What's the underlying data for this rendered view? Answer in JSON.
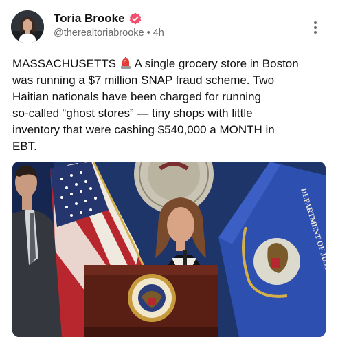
{
  "post": {
    "author_name": "Toria Brooke",
    "handle": "@therealtoriabrooke",
    "separator": "•",
    "time_ago": "4h",
    "text_before_icon": "MASSACHUSETTS ",
    "icon": "siren-emoji",
    "text_after_icon": " A single grocery store in Boston\nwas running a $7 million SNAP fraud scheme. Two\nHaitian nationals have been charged for running\nso-called “ghost stores” — tiny shops with little\ninventory that were cashing $540,000 a MONTH in\nEBT.",
    "media": {
      "podium_seal_text": "DEPARTMENT OF JUSTICE",
      "flag_text": "DEPARTMENT OF JUSTICE"
    }
  },
  "colors": {
    "verified_badge": "#f0506e",
    "doj_flag": "#2c4fb0",
    "podium": "#5a1f14"
  }
}
